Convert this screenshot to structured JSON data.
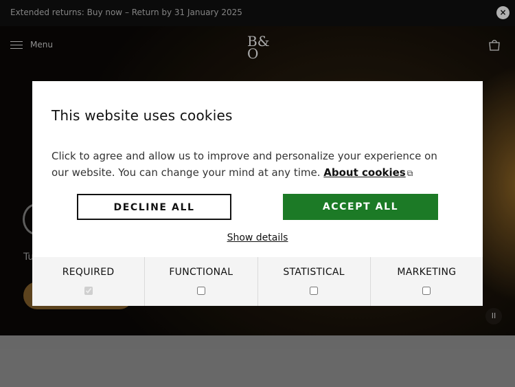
{
  "announcement": {
    "text": "Extended returns: Buy now – Return by 31 January 2025",
    "close_icon": "close-icon"
  },
  "header": {
    "menu_label": "Menu",
    "logo_top": "B&",
    "logo_bottom": "O"
  },
  "hero": {
    "subtitle_fragment": "Tu",
    "pause_symbol": "II"
  },
  "cookie_modal": {
    "title": "This website uses cookies",
    "body_text": "Click to agree and allow us to improve and personalize your experience on our website. You can change your mind at any time.",
    "about_link": "About cookies",
    "decline_label": "DECLINE ALL",
    "accept_label": "ACCEPT ALL",
    "show_details": "Show details",
    "accept_color": "#1c7a26",
    "categories": [
      {
        "label": "REQUIRED",
        "checked": true,
        "disabled": true
      },
      {
        "label": "FUNCTIONAL",
        "checked": false,
        "disabled": false
      },
      {
        "label": "STATISTICAL",
        "checked": false,
        "disabled": false
      },
      {
        "label": "MARKETING",
        "checked": false,
        "disabled": false
      }
    ]
  }
}
